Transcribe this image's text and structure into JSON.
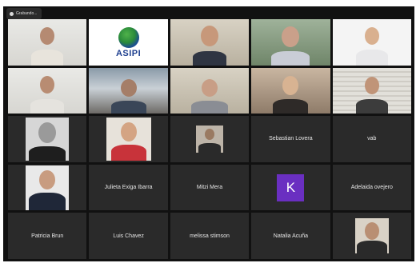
{
  "recording": {
    "label": "Grabando..."
  },
  "logo": {
    "text": "ASIPI"
  },
  "participants": {
    "sebastian": "Sebastian Lovera",
    "vab": "vab",
    "julieta": "Julieta Exiga Ibarra",
    "mitzi": "Mitzi Mera",
    "adelaida": "Adelaida ovejero",
    "patricia": "Patricia Brun",
    "luis": "Luis Chavez",
    "melissa": "melissa stimson",
    "natalia": "Natalia Acuña"
  },
  "avatar": {
    "initial": "K",
    "color": "#6a2fc1"
  },
  "colors": {
    "tile": "#2a2a2a",
    "active_speaker_outline": "#d8e27a",
    "background": "#111111"
  },
  "icons": [
    "recording-icon",
    "asipi-globe-icon"
  ]
}
